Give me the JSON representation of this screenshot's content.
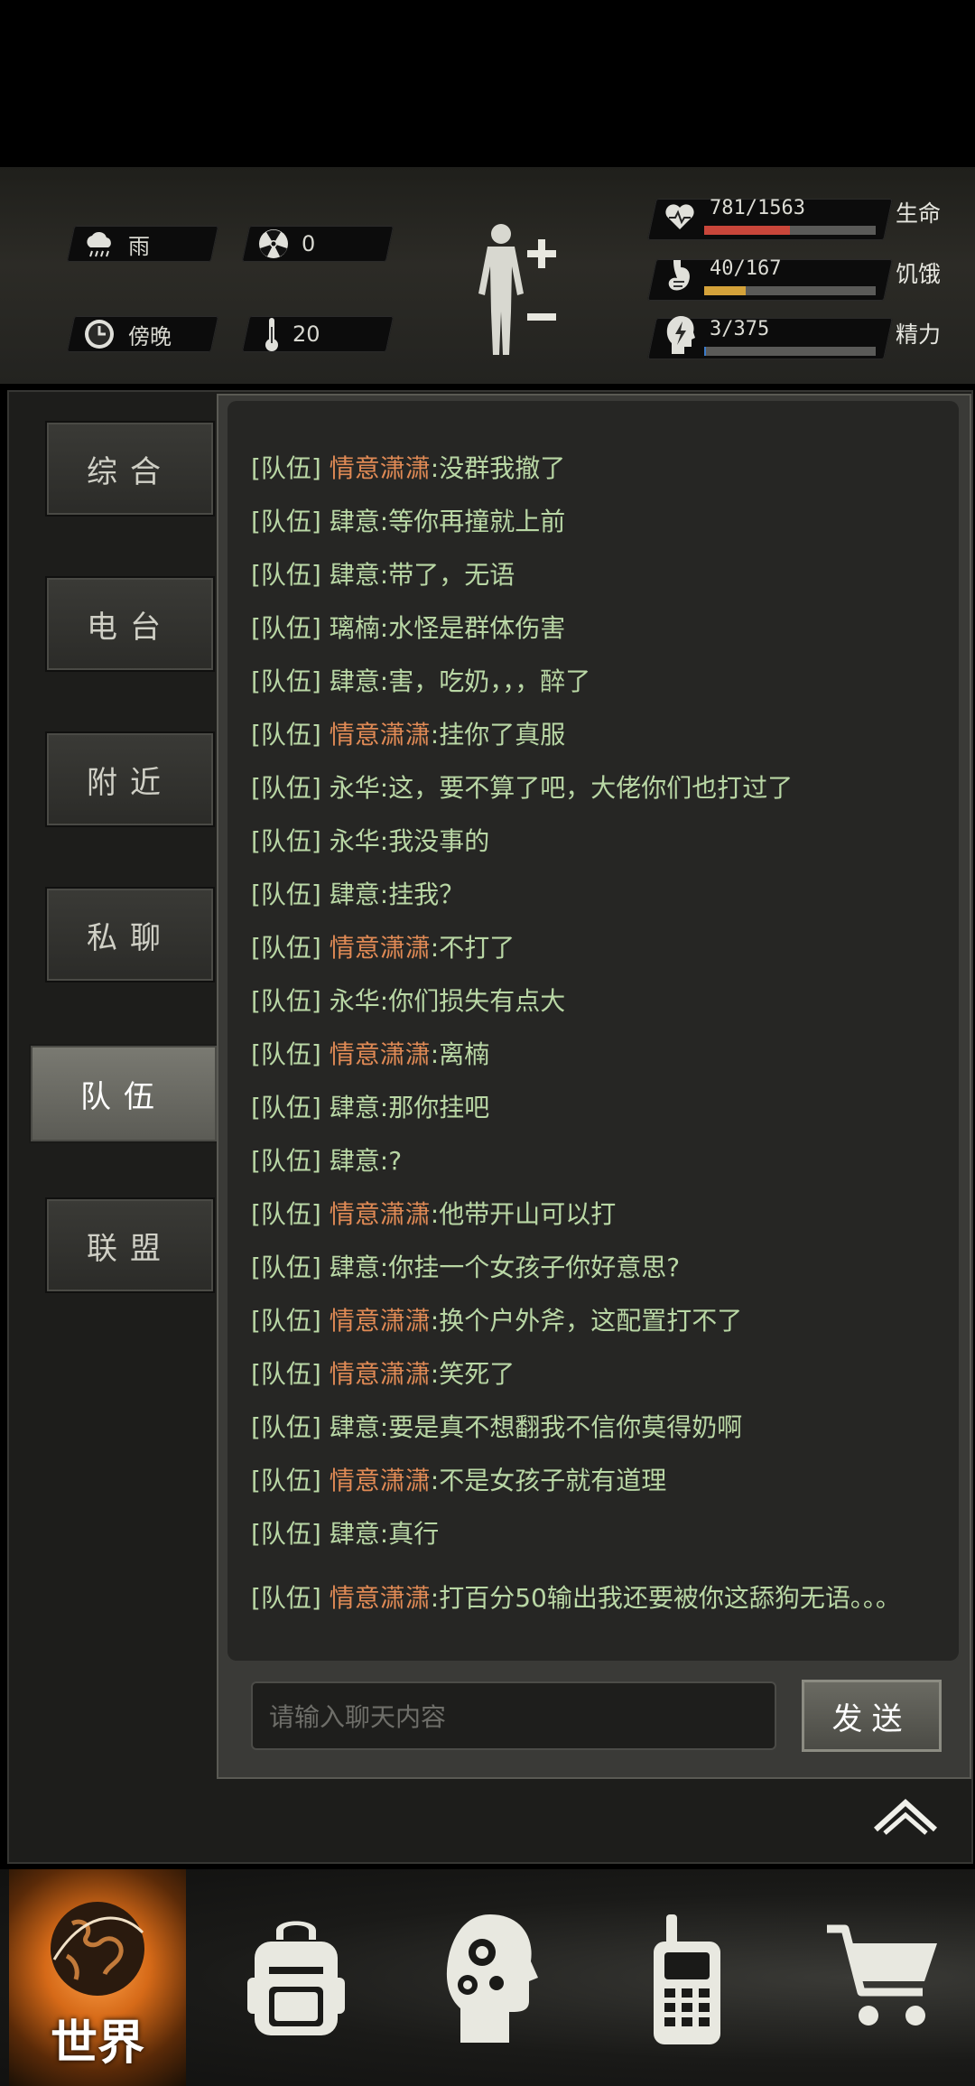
{
  "status": {
    "weather": {
      "icon": "rain-cloud-icon",
      "label": "雨"
    },
    "radiation": {
      "icon": "radiation-icon",
      "value": "0"
    },
    "time_of_day": {
      "icon": "clock-icon",
      "label": "傍晚"
    },
    "temperature": {
      "icon": "thermometer-icon",
      "value": "20"
    },
    "stats": [
      {
        "name": "生命",
        "value": "781/1563",
        "icon": "heart-icon",
        "fraction": 0.5,
        "color": "#c9463a"
      },
      {
        "name": "饥饿",
        "value": "40/167",
        "icon": "stomach-icon",
        "fraction": 0.24,
        "color": "#d4a23a"
      },
      {
        "name": "精力",
        "value": "3/375",
        "icon": "energy-head-icon",
        "fraction": 0.01,
        "color": "#3a7ac9"
      }
    ]
  },
  "tabs": [
    {
      "label": "综合"
    },
    {
      "label": "电台"
    },
    {
      "label": "附近"
    },
    {
      "label": "私聊"
    },
    {
      "label": "队伍",
      "active": true
    },
    {
      "label": "联盟"
    }
  ],
  "messages": [
    {
      "channel": "[队伍]",
      "name": "情意潇潇",
      "name_color": "orange",
      "text": ":没群我撤了"
    },
    {
      "channel": "[队伍]",
      "name": "肆意",
      "name_color": "green",
      "text": ":等你再撞就上前"
    },
    {
      "channel": "[队伍]",
      "name": "肆意",
      "name_color": "green",
      "text": ":带了，无语"
    },
    {
      "channel": "[队伍]",
      "name": "璃楠",
      "name_color": "green",
      "text": ":水怪是群体伤害"
    },
    {
      "channel": "[队伍]",
      "name": "肆意",
      "name_color": "green",
      "text": ":害，吃奶，，，醉了"
    },
    {
      "channel": "[队伍]",
      "name": "情意潇潇",
      "name_color": "orange",
      "text": ":挂你了真服"
    },
    {
      "channel": "[队伍]",
      "name": "永华",
      "name_color": "green",
      "text": ":这，要不算了吧，大佬你们也打过了"
    },
    {
      "channel": "[队伍]",
      "name": "永华",
      "name_color": "green",
      "text": ":我没事的"
    },
    {
      "channel": "[队伍]",
      "name": "肆意",
      "name_color": "green",
      "text": ":挂我？"
    },
    {
      "channel": "[队伍]",
      "name": "情意潇潇",
      "name_color": "orange",
      "text": ":不打了"
    },
    {
      "channel": "[队伍]",
      "name": "永华",
      "name_color": "green",
      "text": ":你们损失有点大"
    },
    {
      "channel": "[队伍]",
      "name": "情意潇潇",
      "name_color": "orange",
      "text": ":离楠"
    },
    {
      "channel": "[队伍]",
      "name": "肆意",
      "name_color": "green",
      "text": ":那你挂吧"
    },
    {
      "channel": "[队伍]",
      "name": "肆意",
      "name_color": "green",
      "text": ":?"
    },
    {
      "channel": "[队伍]",
      "name": "情意潇潇",
      "name_color": "orange",
      "text": ":他带开山可以打"
    },
    {
      "channel": "[队伍]",
      "name": "肆意",
      "name_color": "green",
      "text": ":你挂一个女孩子你好意思?"
    },
    {
      "channel": "[队伍]",
      "name": "情意潇潇",
      "name_color": "orange",
      "text": ":换个户外斧，这配置打不了"
    },
    {
      "channel": "[队伍]",
      "name": "情意潇潇",
      "name_color": "orange",
      "text": ":笑死了"
    },
    {
      "channel": "[队伍]",
      "name": "肆意",
      "name_color": "green",
      "text": ":要是真不想翻我不信你莫得奶啊"
    },
    {
      "channel": "[队伍]",
      "name": "情意潇潇",
      "name_color": "orange",
      "text": ":不是女孩子就有道理"
    },
    {
      "channel": "[队伍]",
      "name": "肆意",
      "name_color": "green",
      "text": ":真行"
    },
    {
      "channel": "[队伍]",
      "name": "情意潇潇",
      "name_color": "orange",
      "text": ":打百分50输出我还要被你这舔狗无语。。。"
    }
  ],
  "input": {
    "placeholder": "请输入聊天内容"
  },
  "send_label": "发送",
  "bottom_nav": [
    {
      "icon": "globe-icon",
      "label": "世界",
      "active": true
    },
    {
      "icon": "backpack-icon"
    },
    {
      "icon": "head-gears-icon"
    },
    {
      "icon": "walkie-talkie-icon"
    },
    {
      "icon": "shopping-cart-icon"
    }
  ]
}
